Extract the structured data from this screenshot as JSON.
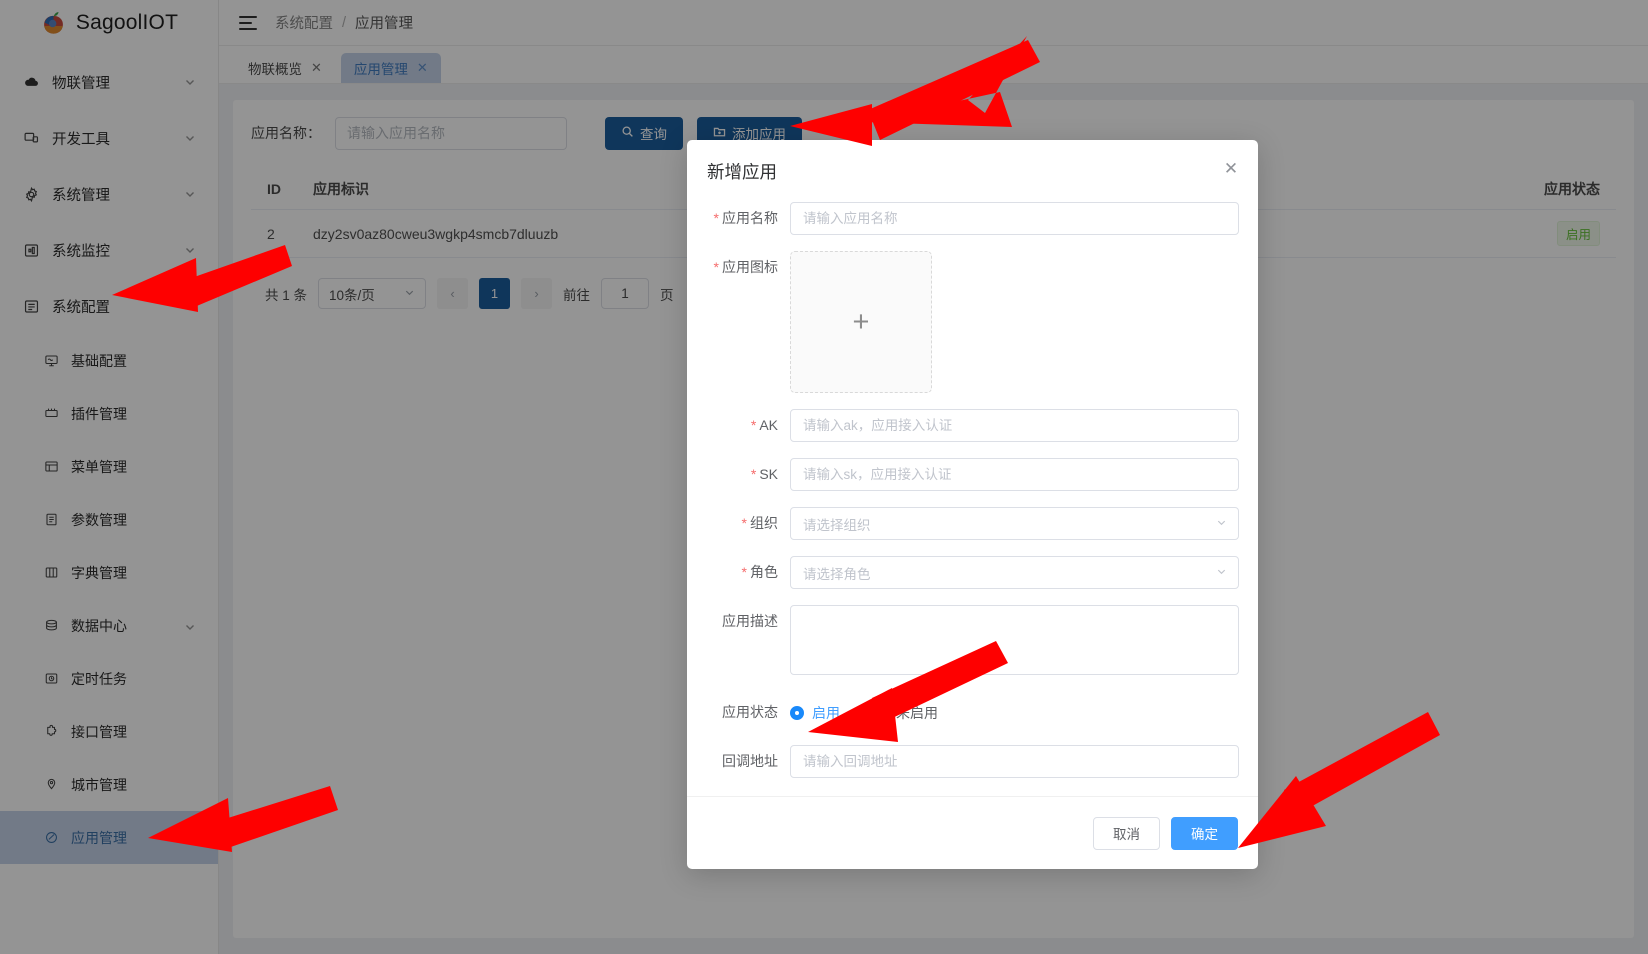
{
  "brand": {
    "name": "SagoolIOT",
    "logo_icon": "apple-logo-icon"
  },
  "sidebar": {
    "items": [
      {
        "label": "物联管理",
        "icon": "cloud-icon",
        "expandable": true,
        "expanded": false
      },
      {
        "label": "开发工具",
        "icon": "devtools-icon",
        "expandable": true,
        "expanded": false
      },
      {
        "label": "系统管理",
        "icon": "gear-icon",
        "expandable": true,
        "expanded": false
      },
      {
        "label": "系统监控",
        "icon": "monitor-icon",
        "expandable": true,
        "expanded": false
      },
      {
        "label": "系统配置",
        "icon": "settings-config-icon",
        "expandable": true,
        "expanded": true
      }
    ],
    "sub_items": [
      {
        "label": "基础配置",
        "icon": "screen-icon",
        "active": false
      },
      {
        "label": "插件管理",
        "icon": "plugin-icon",
        "active": false
      },
      {
        "label": "菜单管理",
        "icon": "menu-list-icon",
        "active": false
      },
      {
        "label": "参数管理",
        "icon": "document-icon",
        "active": false
      },
      {
        "label": "字典管理",
        "icon": "columns-icon",
        "active": false
      },
      {
        "label": "数据中心",
        "icon": "database-icon",
        "active": false,
        "expandable": true
      },
      {
        "label": "定时任务",
        "icon": "clock-task-icon",
        "active": false
      },
      {
        "label": "接口管理",
        "icon": "puzzle-icon",
        "active": false
      },
      {
        "label": "城市管理",
        "icon": "location-icon",
        "active": false
      },
      {
        "label": "应用管理",
        "icon": "app-ring-icon",
        "active": true
      }
    ]
  },
  "topbar": {
    "menu_toggle_icon": "hamburger-icon",
    "breadcrumb": {
      "parent": "系统配置",
      "separator": "/",
      "current": "应用管理"
    }
  },
  "tabs": [
    {
      "label": "物联概览",
      "active": false,
      "close_icon": "✕"
    },
    {
      "label": "应用管理",
      "active": true,
      "close_icon": "✕"
    }
  ],
  "toolbar": {
    "search_label": "应用名称：",
    "search_value": "",
    "search_placeholder": "请输入应用名称",
    "query_label": "查询",
    "query_icon": "search-icon",
    "add_label": "添加应用",
    "add_icon": "folder-plus-icon",
    "primary_color": "#1b5e9e"
  },
  "table": {
    "columns": {
      "id": "ID",
      "app_key": "应用标识",
      "status": "应用状态"
    },
    "rows": [
      {
        "id": "2",
        "app_key": "dzy2sv0az80cweu3wgkp4smcb7dluuzb",
        "status": "启用"
      }
    ],
    "status_color": "#67c23a"
  },
  "pagination": {
    "total_text": "共 1 条",
    "page_size": "10条/页",
    "prev_icon": "‹",
    "next_icon": "›",
    "current_page": "1",
    "jump_prefix": "前往",
    "jump_value": "1",
    "jump_suffix": "页"
  },
  "modal": {
    "title": "新增应用",
    "close_icon": "✕",
    "fields": {
      "app_name": {
        "label": "应用名称",
        "required": true,
        "value": "",
        "placeholder": "请输入应用名称"
      },
      "app_icon": {
        "label": "应用图标",
        "required": true,
        "upload_icon": "plus-icon"
      },
      "ak": {
        "label": "AK",
        "required": true,
        "value": "",
        "placeholder": "请输入ak，应用接入认证"
      },
      "sk": {
        "label": "SK",
        "required": true,
        "value": "",
        "placeholder": "请输入sk，应用接入认证"
      },
      "org": {
        "label": "组织",
        "required": true,
        "value": "请选择组织",
        "chevron_icon": "chevron-down-icon"
      },
      "role": {
        "label": "角色",
        "required": true,
        "value": "请选择角色",
        "chevron_icon": "chevron-down-icon"
      },
      "description": {
        "label": "应用描述",
        "required": false,
        "value": "",
        "placeholder": ""
      },
      "status": {
        "label": "应用状态",
        "options": [
          {
            "label": "启用",
            "selected": true
          },
          {
            "label": "未启用",
            "selected": false
          }
        ],
        "accent_color": "#409eff"
      },
      "callback": {
        "label": "回调地址",
        "required": false,
        "value": "",
        "placeholder": "请输入回调地址"
      }
    },
    "cancel_label": "取消",
    "confirm_label": "确定",
    "confirm_color": "#409eff"
  },
  "annotations": {
    "arrow_color": "#fe0000",
    "arrows": [
      {
        "name": "arrow-to-add-app-button"
      },
      {
        "name": "arrow-to-sidebar-system-config"
      },
      {
        "name": "arrow-to-status-enabled-radio"
      },
      {
        "name": "arrow-to-sidebar-app-management"
      },
      {
        "name": "arrow-to-confirm-button"
      }
    ]
  }
}
